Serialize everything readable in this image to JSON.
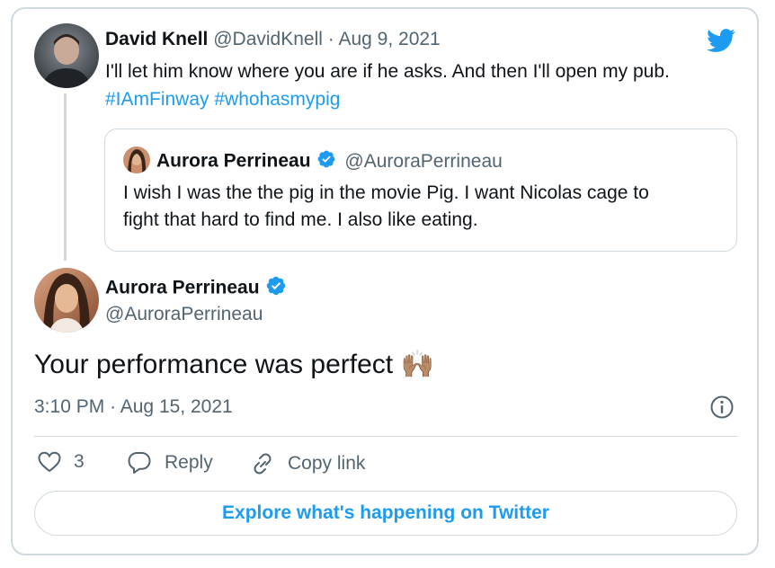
{
  "parent_tweet": {
    "author_name": "David Knell",
    "author_handle": "@DavidKnell",
    "separator": "·",
    "date": "Aug 9, 2021",
    "text": "I'll let him know where you are if he asks. And then I'll open my pub.",
    "hashtags": [
      "#IAmFinway",
      "#whohasmypig"
    ]
  },
  "quoted_tweet": {
    "author_name": "Aurora Perrineau",
    "author_handle": "@AuroraPerrineau",
    "text_line1": "I wish I was the the pig in the movie Pig. I want Nicolas cage to",
    "text_line2": "fight that hard to find me. I also like eating."
  },
  "main_tweet": {
    "author_name": "Aurora Perrineau",
    "author_handle": "@AuroraPerrineau",
    "text": "Your performance was perfect",
    "emoji": "🙌🏽",
    "time": "3:10 PM",
    "separator": "·",
    "date": "Aug 15, 2021"
  },
  "actions": {
    "like_count": "3",
    "reply_label": "Reply",
    "copy_link_label": "Copy link"
  },
  "cta_label": "Explore what's happening on Twitter",
  "colors": {
    "accent": "#1d9bf0",
    "border": "#cfd9de",
    "muted_text": "#536471"
  },
  "icons": [
    "twitter-bird-icon",
    "verified-badge-icon",
    "info-icon",
    "heart-icon",
    "reply-icon",
    "link-icon"
  ]
}
